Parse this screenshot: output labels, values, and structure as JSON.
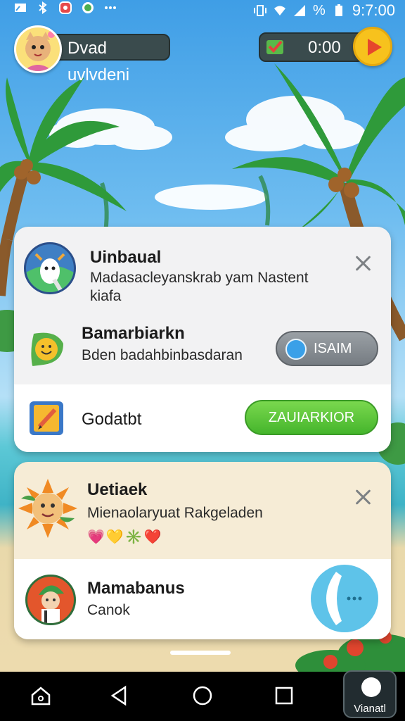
{
  "status_bar": {
    "time": "9:7:00",
    "battery": "%",
    "icons": [
      "screen-cast-icon",
      "bluetooth-icon",
      "notification-icon",
      "chat-icon",
      "more-dots-icon",
      "vibrate-icon",
      "wifi-icon",
      "signal-icon",
      "battery-icon"
    ]
  },
  "header": {
    "player_name": "Dvad uvlvdeni",
    "timer": "0:00",
    "play_icon": "play-icon"
  },
  "card_top": {
    "row1": {
      "title": "Uinbaual",
      "line1": "Madasacleyanskrab yam Nastent",
      "line2": "kiafa"
    },
    "row2": {
      "title": "Bamarbiarkn",
      "subtitle": "Bden badahbinbasdaran",
      "button": "ISAIM"
    },
    "row3": {
      "title": "Godatbt",
      "button": "ZAUIARKIOR"
    }
  },
  "card_bottom": {
    "row1": {
      "title": "Uetiaek",
      "subtitle": "Mienaolaryuat Rakgeladen",
      "emojis": "💗💛✳️❤️"
    },
    "row2": {
      "title": "Mamabanus",
      "subtitle": "Canok"
    }
  },
  "navbar": {
    "extra_label": "Vianatl"
  },
  "colors": {
    "green_button": "#45b52c",
    "play_button": "#f7c21d",
    "call_button": "#5ec3e9"
  }
}
